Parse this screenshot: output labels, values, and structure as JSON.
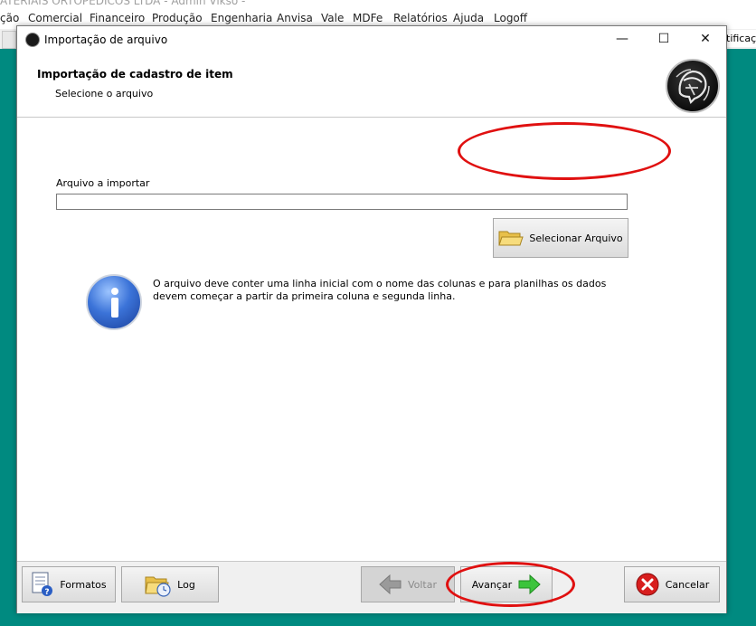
{
  "background": {
    "window_title": "ATERIAIS ORTOPÉDICOS LTDA - Admin Vikso -",
    "menu_items": [
      "ção",
      "Comercial",
      "Financeiro",
      "Produção",
      "Engenharia",
      "Anvisa",
      "Vale",
      "MDFe",
      "Relatórios",
      "Ajuda",
      "Logoff"
    ],
    "toolbar_right_text": "tificaçõ"
  },
  "dialog": {
    "title": "Importação de arquivo",
    "controls": {
      "minimize": "—",
      "maximize": "☐",
      "close": "✕"
    },
    "header": {
      "title": "Importação de cadastro de item",
      "subtitle": "Selecione o arquivo"
    },
    "file_field": {
      "label": "Arquivo a importar",
      "value": "",
      "placeholder": ""
    },
    "select_button_label": "Selecionar Arquivo",
    "info_message": "O arquivo deve conter uma linha inicial com o nome das colunas e para planilhas os dados devem começar a partir da primeira coluna e segunda linha.",
    "footer": {
      "formatos_label": "Formatos",
      "log_label": "Log",
      "voltar_label": "Voltar",
      "avancar_label": "Avançar",
      "cancelar_label": "Cancelar"
    }
  },
  "colors": {
    "desktop_teal": "#008a80",
    "highlight_red": "#e01010",
    "arrow_green": "#3cc43c",
    "cancel_red": "#d81e1e"
  },
  "icons": {
    "app": "helmet-logo-icon",
    "folder": "folder-open-icon",
    "info": "info-icon",
    "formatos": "document-help-icon",
    "log": "folder-clock-icon",
    "voltar": "arrow-left-icon",
    "avancar": "arrow-right-icon",
    "cancelar": "cancel-x-icon"
  }
}
